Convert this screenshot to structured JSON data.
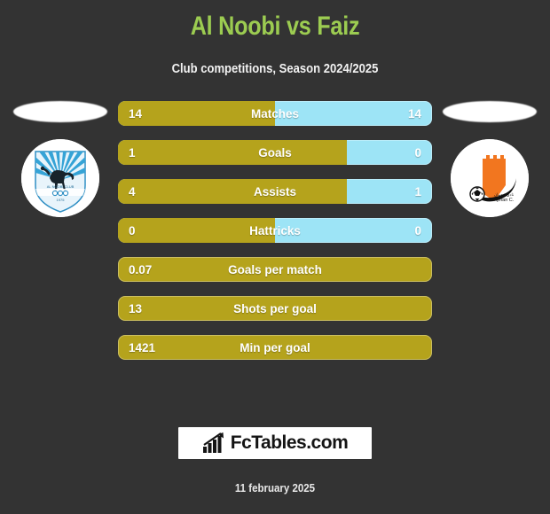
{
  "header": {
    "title": "Al Noobi vs Faiz",
    "subtitle": "Club competitions, Season 2024/2025",
    "title_color": "#9ccc51"
  },
  "teams": {
    "home": {
      "name": "Al Noobi",
      "badge_icon": "camel-shield-badge"
    },
    "away": {
      "name": "Faiz",
      "badge_icon": "ajman-club-badge"
    }
  },
  "colors": {
    "background": "#333333",
    "home_bar": "#b5a31c",
    "away_bar": "#9de4f6",
    "title": "#9ccc51",
    "text": "#ffffff"
  },
  "chart_data": {
    "type": "bar",
    "title": "Al Noobi vs Faiz",
    "subtitle": "Club competitions, Season 2024/2025",
    "categories": [
      "Matches",
      "Goals",
      "Assists",
      "Hattricks",
      "Goals per match",
      "Shots per goal",
      "Min per goal"
    ],
    "series": [
      {
        "name": "Al Noobi",
        "values": [
          "14",
          "1",
          "4",
          "0",
          "0.07",
          "13",
          "1421"
        ]
      },
      {
        "name": "Faiz",
        "values": [
          "14",
          "0",
          "1",
          "0",
          null,
          null,
          null
        ]
      }
    ],
    "legend_position": "none",
    "grid": false,
    "orientation": "horizontal-split"
  },
  "rows": [
    {
      "label": "Matches",
      "home": "14",
      "away": "14",
      "home_pct": 50,
      "split": true
    },
    {
      "label": "Goals",
      "home": "1",
      "away": "0",
      "home_pct": 73,
      "split": true
    },
    {
      "label": "Assists",
      "home": "4",
      "away": "1",
      "home_pct": 73,
      "split": true
    },
    {
      "label": "Hattricks",
      "home": "0",
      "away": "0",
      "home_pct": 50,
      "split": true
    },
    {
      "label": "Goals per match",
      "home": "0.07",
      "away": "",
      "home_pct": 100,
      "split": false
    },
    {
      "label": "Shots per goal",
      "home": "13",
      "away": "",
      "home_pct": 100,
      "split": false
    },
    {
      "label": "Min per goal",
      "home": "1421",
      "away": "",
      "home_pct": 100,
      "split": false
    }
  ],
  "footer": {
    "brand": "FcTables.com",
    "brand_icon": "bar-chart-arrow-icon",
    "date": "11 february 2025"
  }
}
